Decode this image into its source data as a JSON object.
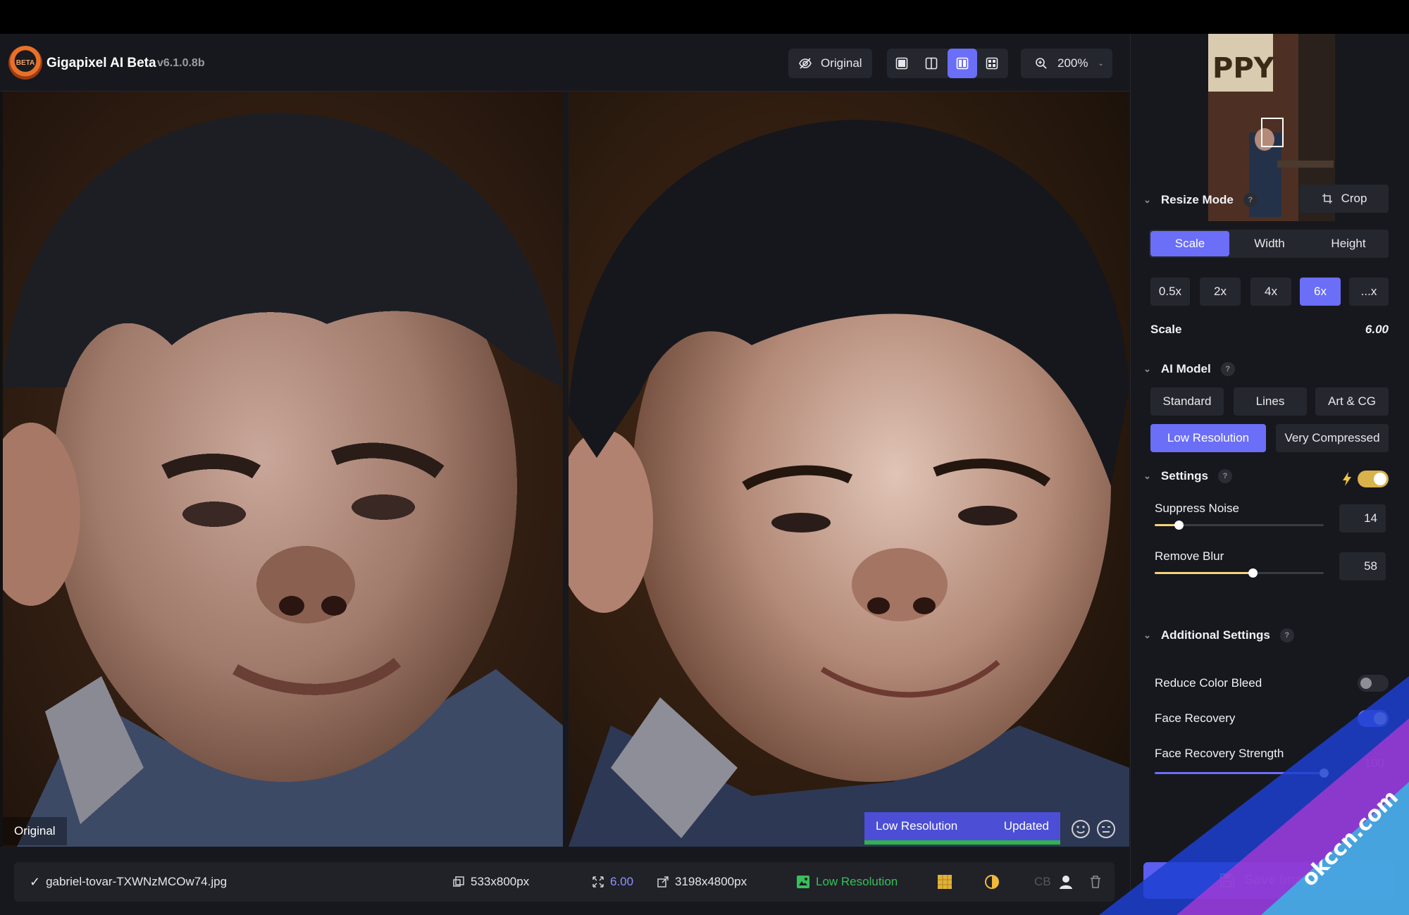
{
  "app": {
    "title": "Gigapixel AI Beta",
    "version": "v6.1.0.8b",
    "logo_text": "BETA"
  },
  "toolbar": {
    "original_label": "Original",
    "zoom_label": "200%",
    "view_modes": [
      "single-view",
      "split-view",
      "side-by-side-view",
      "quad-view"
    ],
    "active_view": "side-by-side-view"
  },
  "viewer": {
    "left_label": "Original",
    "model_status": "Low Resolution",
    "update_status": "Updated",
    "progress": 1.0
  },
  "bottombar": {
    "filename": "gabriel-tovar-TXWNzMCOw74.jpg",
    "input_size": "533x800px",
    "scale": "6.00",
    "output_size": "3198x4800px",
    "model": "Low Resolution",
    "cb_label": "CB"
  },
  "panel": {
    "preview_sign_text": "PPY",
    "resize_mode": {
      "heading": "Resize Mode",
      "help": "?",
      "crop_label": "Crop",
      "modes": [
        "Scale",
        "Width",
        "Height"
      ],
      "active_mode": "Scale",
      "scales": [
        "0.5x",
        "2x",
        "4x",
        "6x",
        "...x"
      ],
      "active_scale": "6x",
      "scale_label": "Scale",
      "scale_value": "6.00"
    },
    "ai_model": {
      "heading": "AI Model",
      "help": "?",
      "models": [
        "Standard",
        "Lines",
        "Art & CG",
        "Low Resolution",
        "Very Compressed"
      ],
      "active_model": "Low Resolution"
    },
    "settings": {
      "heading": "Settings",
      "help": "?",
      "auto_enabled": true,
      "suppress_noise_label": "Suppress Noise",
      "suppress_noise_value": "14",
      "suppress_noise_level": 14,
      "remove_blur_label": "Remove Blur",
      "remove_blur_value": "58",
      "remove_blur_level": 58
    },
    "additional": {
      "heading": "Additional Settings",
      "help": "?",
      "reduce_color_bleed_label": "Reduce Color Bleed",
      "reduce_color_bleed_on": false,
      "face_recovery_label": "Face Recovery",
      "face_recovery_on": true,
      "face_recovery_strength_label": "Face Recovery Strength",
      "face_recovery_strength_value": "100",
      "face_recovery_strength_level": 100
    },
    "save_label": "Save Image"
  },
  "watermark": {
    "text": "okccn.com"
  },
  "colors": {
    "accent": "#6b6ef7",
    "success": "#2fb34a",
    "slider": "#f4d37a",
    "background": "#17181d"
  }
}
